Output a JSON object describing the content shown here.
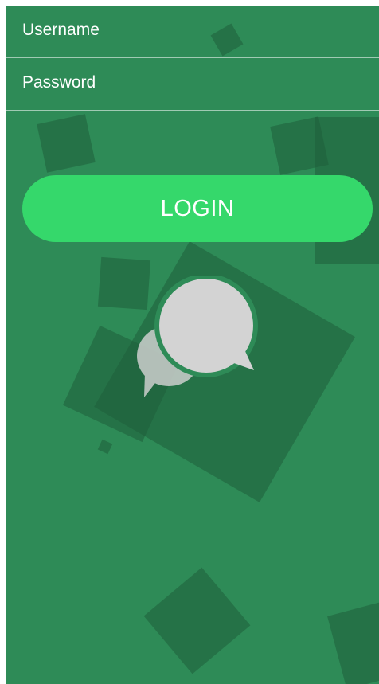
{
  "form": {
    "username_placeholder": "Username",
    "password_placeholder": "Password",
    "login_label": "LOGIN"
  },
  "icons": {
    "logo": "chat-bubbles-icon"
  },
  "colors": {
    "background": "#2e8b57",
    "shape": "#1f5e3b",
    "button": "#35d86b",
    "bubble": "#d3d3d3"
  }
}
